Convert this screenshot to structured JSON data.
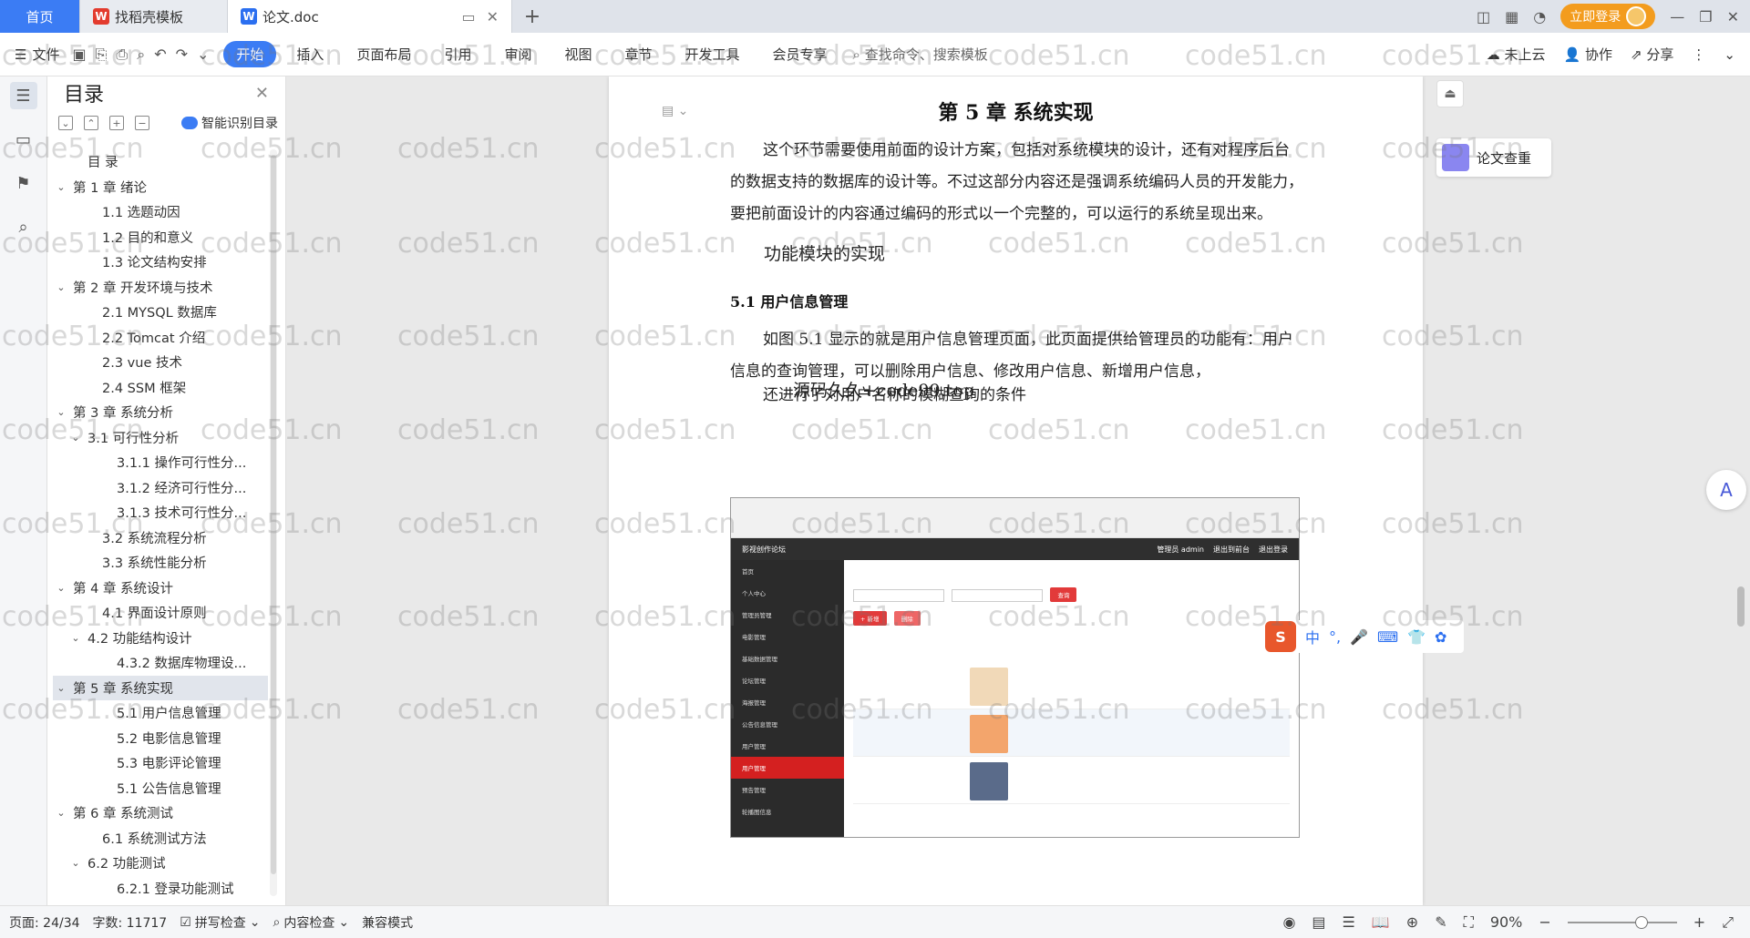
{
  "tabs": {
    "home": "首页",
    "template": "找稻壳模板",
    "doc": "论文.doc"
  },
  "titlebar": {
    "login": "立即登录"
  },
  "menu": {
    "file": "文件",
    "items": [
      "开始",
      "插入",
      "页面布局",
      "引用",
      "审阅",
      "视图",
      "章节",
      "开发工具",
      "会员专享"
    ],
    "search": "查找命令、搜索模板",
    "cloud": "未上云",
    "collab": "协作",
    "share": "分享"
  },
  "toc": {
    "title": "目录",
    "smart": "智能识别目录",
    "rows": [
      {
        "text": "目  录",
        "level": 1,
        "arrow": ""
      },
      {
        "text": "第 1 章  绪论",
        "level": 0,
        "arrow": "v"
      },
      {
        "text": "1.1 选题动因",
        "level": 2,
        "arrow": ""
      },
      {
        "text": "1.2 目的和意义",
        "level": 2,
        "arrow": ""
      },
      {
        "text": "1.3 论文结构安排",
        "level": 2,
        "arrow": ""
      },
      {
        "text": "第 2 章  开发环境与技术",
        "level": 0,
        "arrow": "v"
      },
      {
        "text": "2.1 MYSQL 数据库",
        "level": 2,
        "arrow": ""
      },
      {
        "text": "2.2 Tomcat  介绍",
        "level": 2,
        "arrow": ""
      },
      {
        "text": "2.3 vue 技术",
        "level": 2,
        "arrow": ""
      },
      {
        "text": "2.4 SSM 框架",
        "level": 2,
        "arrow": ""
      },
      {
        "text": "第 3 章  系统分析",
        "level": 0,
        "arrow": "v"
      },
      {
        "text": "3.1 可行性分析",
        "level": 1,
        "arrow": "v"
      },
      {
        "text": "3.1.1 操作可行性分...",
        "level": 3,
        "arrow": ""
      },
      {
        "text": "3.1.2 经济可行性分...",
        "level": 3,
        "arrow": ""
      },
      {
        "text": "3.1.3 技术可行性分...",
        "level": 3,
        "arrow": ""
      },
      {
        "text": "3.2 系统流程分析",
        "level": 2,
        "arrow": ""
      },
      {
        "text": "3.3 系统性能分析",
        "level": 2,
        "arrow": ""
      },
      {
        "text": "第 4 章  系统设计",
        "level": 0,
        "arrow": "v"
      },
      {
        "text": "4.1 界面设计原则",
        "level": 2,
        "arrow": ""
      },
      {
        "text": "4.2 功能结构设计",
        "level": 1,
        "arrow": "v"
      },
      {
        "text": "4.3.2  数据库物理设...",
        "level": 3,
        "arrow": ""
      },
      {
        "text": "第 5 章  系统实现",
        "level": 0,
        "arrow": "v",
        "selected": true
      },
      {
        "text": "5.1 用户信息管理",
        "level": 3,
        "arrow": ""
      },
      {
        "text": "5.2  电影信息管理",
        "level": 3,
        "arrow": ""
      },
      {
        "text": "5.3 电影评论管理",
        "level": 3,
        "arrow": ""
      },
      {
        "text": "5.1 公告信息管理",
        "level": 3,
        "arrow": ""
      },
      {
        "text": "第 6 章  系统测试",
        "level": 0,
        "arrow": "v"
      },
      {
        "text": "6.1  系统测试方法",
        "level": 2,
        "arrow": ""
      },
      {
        "text": "6.2  功能测试",
        "level": 1,
        "arrow": "v"
      },
      {
        "text": "6.2.1  登录功能测试",
        "level": 3,
        "arrow": ""
      }
    ]
  },
  "document": {
    "heading": "第 5 章  系统实现",
    "intro": "这个环节需要使用前面的设计方案，包括对系统模块的设计，还有对程序后台的数据支持的数据库的设计等。不过这部分内容还是强调系统编码人员的开发能力，要把前面设计的内容通过编码的形式以一个完整的，可以运行的系统呈现出来。",
    "subhead": "功能模块的实现",
    "section": "5.1 用户信息管理",
    "para2": "如图 5.1 显示的就是用户信息管理页面，此页面提供给管理员的功能有：用户信息的查询管理，可以删除用户信息、修改用户信息、新增用户信息，",
    "para3": "还进行了对用户名称的模糊查询的条件",
    "overlay": "源码久久+code99.top"
  },
  "screenshot": {
    "site_title": "影视创作论坛",
    "admin": "管理员 admin",
    "back_home": "退出到前台",
    "logout": "退出登录",
    "add": "+ 新增",
    "delete": "删除",
    "search": "查询",
    "menu_items": [
      "首页",
      "个人中心",
      "管理员管理",
      "电影管理",
      "基础数据管理",
      "论坛管理",
      "海报管理",
      "公告信息管理",
      "用户管理",
      "用户管理",
      "预告管理",
      "轮播图信息"
    ]
  },
  "right_panel": {
    "check": "论文查重"
  },
  "ime": {
    "logo": "S",
    "lang": "中"
  },
  "watermark": "code51.cn",
  "status": {
    "page": "页面: 24/34",
    "words": "字数: 11717",
    "spell": "拼写检查",
    "content": "内容检查",
    "compat": "兼容模式",
    "zoom": "90%"
  },
  "colors": {
    "accent": "#3b7cf4",
    "login": "#f39c1e"
  }
}
